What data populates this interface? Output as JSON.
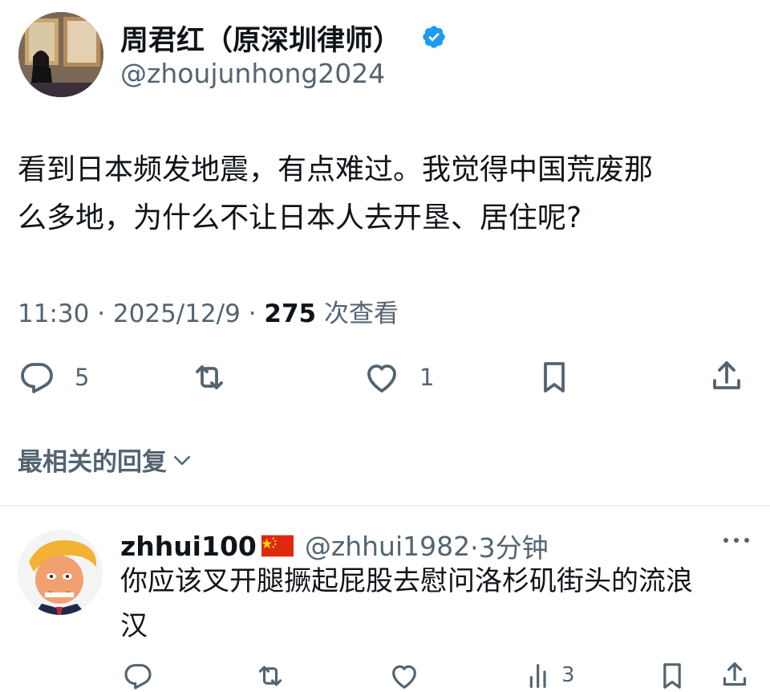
{
  "tweet": {
    "author_name": "周君红（原深圳律师）",
    "author_handle": "@zhoujunhong2024",
    "text_line1": "看到日本频发地震，有点难过。我觉得中国荒废那",
    "text_line2": "么多地，为什么不让日本人去开垦、居住呢?",
    "time": "11:30 · 2025/12/9 · ",
    "views": "275",
    "views_label": " 次查看",
    "reply_count": "5",
    "like_count": "1"
  },
  "replies_sort": {
    "label": "最相关的回复"
  },
  "reply": {
    "author_name": "zhhui100",
    "author_handle": "@zhhui1982",
    "time": "·3分钟",
    "text_line1": "你应该叉开腿撅起屁股去慰问洛杉矶街头的流浪",
    "text_line2": "汉",
    "partial_count": "3"
  },
  "colors": {
    "verified_badge": "#1d9bf0",
    "secondary_text": "#536471",
    "primary_text": "#0f1419",
    "divider": "#eff3f4"
  }
}
